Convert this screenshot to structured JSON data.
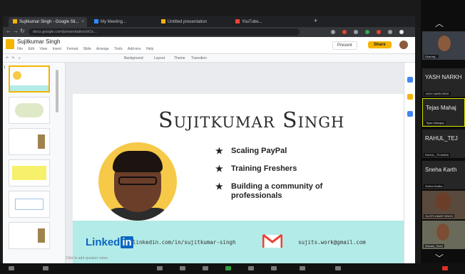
{
  "browser": {
    "tabs": [
      {
        "label": "Sujitkumar Singh - Google Sli..."
      },
      {
        "label": "My Meeting..."
      },
      {
        "label": "Untitled presentation"
      },
      {
        "label": "YouTube..."
      }
    ],
    "url": "docs.google.com/presentation/d/1s..."
  },
  "slides_app": {
    "doc_title": "Sujitkumar Singh",
    "menu": [
      "File",
      "Edit",
      "View",
      "Insert",
      "Format",
      "Slide",
      "Arrange",
      "Tools",
      "Add-ons",
      "Help"
    ],
    "present_label": "Present",
    "share_label": "Share",
    "toolbar": [
      "Background",
      "Layout",
      "Theme",
      "Transition"
    ],
    "speaker_notes": "Click to add speaker notes"
  },
  "slide": {
    "title": "Sujitkumar Singh",
    "bullets": [
      "Scaling PayPal",
      "Training Freshers",
      "Building a community of professionals"
    ],
    "linkedin_word": "Linked",
    "linkedin_in": "in",
    "linkedin_url": "linkedin.com/in/sujitkumar-singh",
    "email": "sujits.work@gmail.com"
  },
  "participants": [
    {
      "name": "",
      "label": "Dhanraj..."
    },
    {
      "name": "YASH NARKH",
      "label": "YASH NARKHEDE"
    },
    {
      "name": "Tejas Mahaj",
      "label": "Tejas Mahajan"
    },
    {
      "name": "RAHUL_TEJ",
      "label": "RAHUL_TEJWANI"
    },
    {
      "name": "Sneha Karth",
      "label": "Sneha Kartha"
    },
    {
      "name": "",
      "label": "SUJITKUMAR SINGH"
    },
    {
      "name": "",
      "label": "Shivani_Tanvi"
    }
  ],
  "colors": {
    "accent": "#f4b400",
    "linkedin": "#0a66c2",
    "footer_band": "#b3ebe8"
  }
}
